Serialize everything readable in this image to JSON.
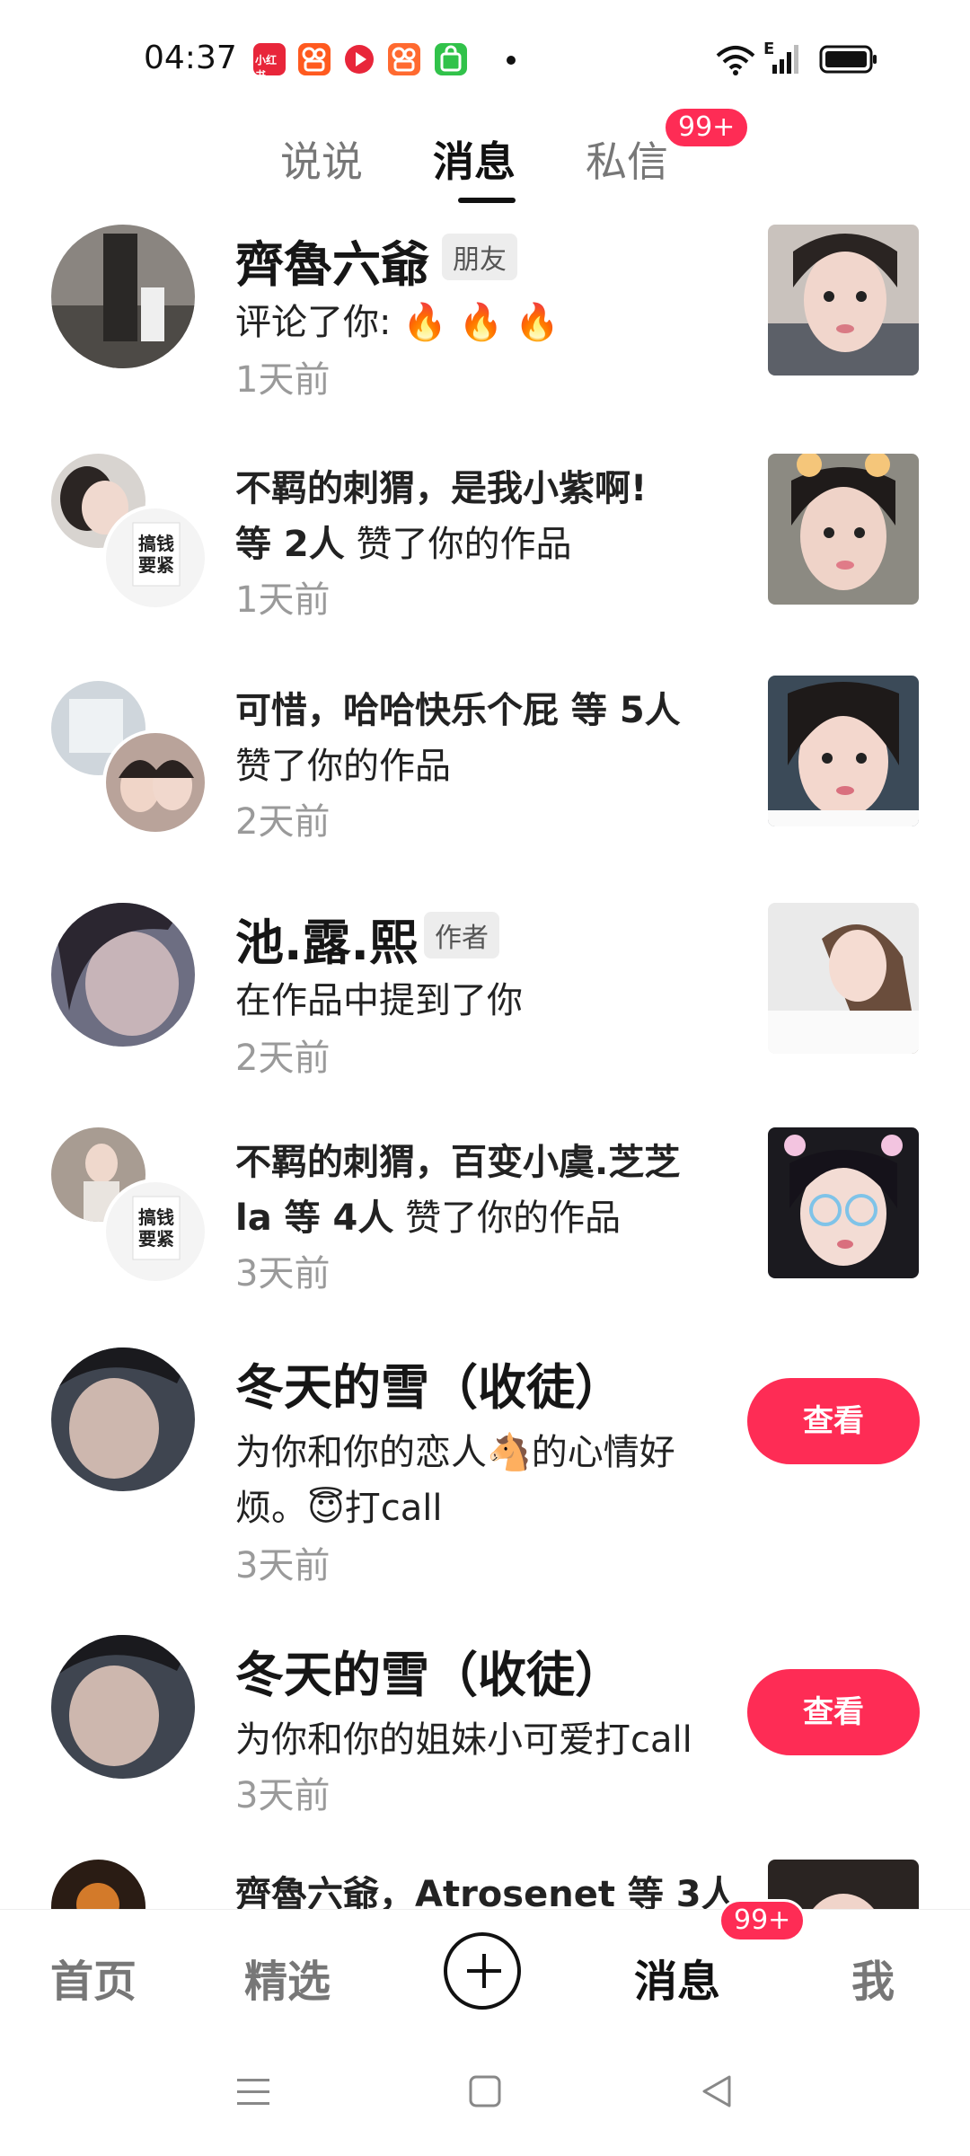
{
  "status_bar": {
    "time": "04:37",
    "app_icons": [
      {
        "name": "xiaohongshu-icon",
        "color": "#e8263a",
        "label": "小红书"
      },
      {
        "name": "kuaishou-icon",
        "color": "#ff5a1f"
      },
      {
        "name": "video-play-icon",
        "color": "#e8263a"
      },
      {
        "name": "kuaishou-icon",
        "color": "#ff6a30"
      },
      {
        "name": "shopping-bag-icon",
        "color": "#31c24a"
      }
    ],
    "network_label": "E"
  },
  "top_tabs": {
    "tabs": [
      "说说",
      "消息",
      "私信"
    ],
    "active_tab": "消息",
    "dm_badge": "99+"
  },
  "messages": [
    {
      "name": "齊魯六爺",
      "tag": "朋友",
      "text": "评论了你: 🔥 🔥 🔥",
      "time": "1天前"
    },
    {
      "line1": "不羁的刺猬，是我小紫啊!",
      "line2_bold": "等 2人",
      "line2_rest": " 赞了你的作品",
      "time": "1天前"
    },
    {
      "line1": "可惜，哈哈快乐个屁 等 5人",
      "line2": "赞了你的作品",
      "time": "2天前"
    },
    {
      "name": "池.露.熙",
      "tag": "作者",
      "text": "在作品中提到了你",
      "time": "2天前"
    },
    {
      "line1": "不羁的刺猬，百变小虞.芝芝",
      "line2_bold": "la 等 4人",
      "line2_rest": " 赞了你的作品",
      "time": "3天前"
    },
    {
      "name": "冬天的雪（收徒）",
      "line1": "为你和你的恋人🐴的心情好",
      "line2": "烦。😇打call",
      "time": "3天前",
      "button": "查看"
    },
    {
      "name": "冬天的雪（收徒）",
      "text": "为你和你的姐妹小可爱打call",
      "time": "3天前",
      "button": "查看"
    },
    {
      "line1": "齊魯六爺，Atrosenet 等 3人"
    }
  ],
  "avatar_text": {
    "poster_line1": "搞钱",
    "poster_line2": "要紧"
  },
  "bottom_nav": {
    "items": [
      "首页",
      "精选",
      "消息",
      "我"
    ],
    "active": "消息",
    "badge": "99+"
  },
  "colors": {
    "accent": "#fe2c55",
    "text": "#161616",
    "muted": "#9a9a9a"
  }
}
